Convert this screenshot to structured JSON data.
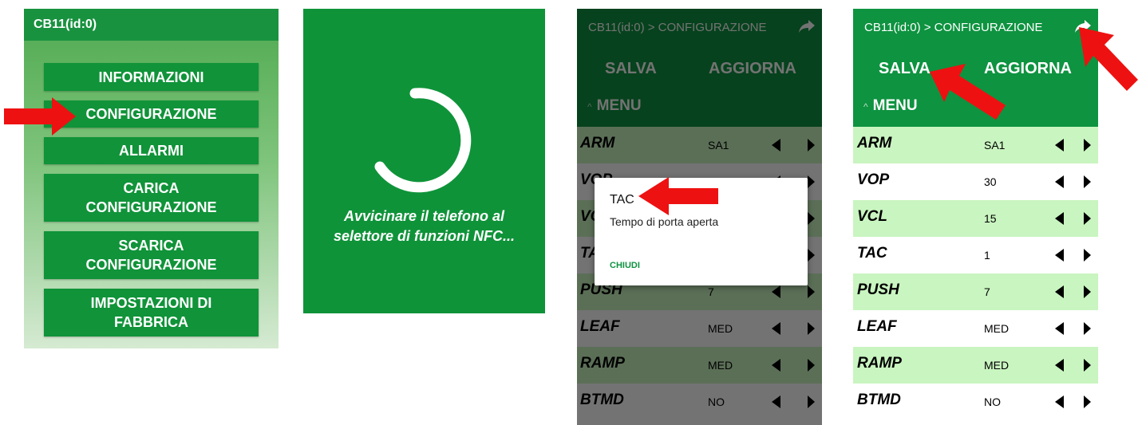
{
  "panel1": {
    "title": "CB11(id:0)",
    "buttons": [
      "INFORMAZIONI",
      "CONFIGURAZIONE",
      "ALLARMI",
      "CARICA\nCONFIGURAZIONE",
      "SCARICA\nCONFIGURAZIONE",
      "IMPOSTAZIONI DI\nFABBRICA"
    ]
  },
  "panel2": {
    "message": "Avvicinare il telefono al\nselettore di funzioni NFC..."
  },
  "config": {
    "title": "CB11(id:0) > CONFIGURAZIONE",
    "save_label": "SALVA",
    "refresh_label": "AGGIORNA",
    "menu_label": "MENU",
    "share_icon": "share-arrow-icon",
    "rows": [
      {
        "key": "ARM",
        "value": "SA1"
      },
      {
        "key": "VOP",
        "value": "30"
      },
      {
        "key": "VCL",
        "value": "15"
      },
      {
        "key": "TAC",
        "value": "1"
      },
      {
        "key": "PUSH",
        "value": "7"
      },
      {
        "key": "LEAF",
        "value": "MED"
      },
      {
        "key": "RAMP",
        "value": "MED"
      },
      {
        "key": "BTMD",
        "value": "NO"
      }
    ]
  },
  "dialog": {
    "title": "TAC",
    "description": "Tempo di porta aperta",
    "close_label": "CHIUDI"
  },
  "colors": {
    "green_header": "#0e9340",
    "row_highlight": "#c9f5c0",
    "annotation_arrow": "#ee1111"
  }
}
